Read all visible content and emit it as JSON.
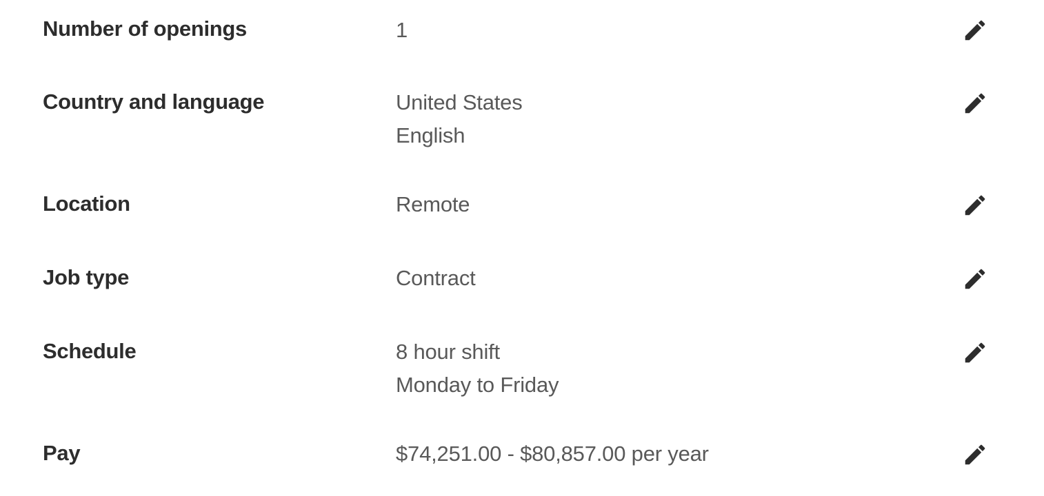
{
  "fields": [
    {
      "label": "Number of openings",
      "values": [
        "1"
      ],
      "action": "edit-icon"
    },
    {
      "label": "Country and language",
      "values": [
        "United States",
        "English"
      ],
      "action": "edit-icon"
    },
    {
      "label": "Location",
      "values": [
        "Remote"
      ],
      "action": "edit-icon"
    },
    {
      "label": "Job type",
      "values": [
        "Contract"
      ],
      "action": "edit-icon"
    },
    {
      "label": "Schedule",
      "values": [
        "8 hour shift",
        "Monday to Friday"
      ],
      "action": "edit-icon"
    },
    {
      "label": "Pay",
      "values": [
        "$74,251.00 - $80,857.00 per year"
      ],
      "action": "edit-icon"
    }
  ],
  "colors": {
    "label": "#2d2d2d",
    "value": "#595959",
    "icon": "#2d2d2d"
  }
}
